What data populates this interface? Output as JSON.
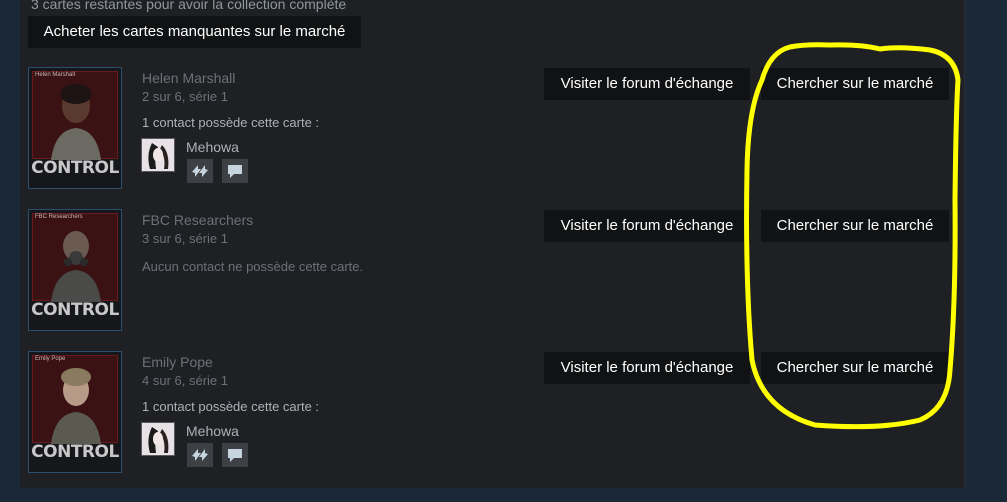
{
  "header": {
    "remaining_note": "3 cartes restantes pour avoir la collection complète",
    "buy_missing_label": "Acheter les cartes manquantes sur le marché"
  },
  "cards": [
    {
      "title": "Helen Marshall",
      "progress": "2 sur 6, série 1",
      "owners_text": "1 contact possède cette carte :",
      "friend_name": "Mehowa",
      "mini_label": "Helen Marshall",
      "logo": "CONTROL",
      "forum_label": "Visiter le forum d'échange",
      "market_label": "Chercher sur le marché"
    },
    {
      "title": "FBC Researchers",
      "progress": "3 sur 6, série 1",
      "owners_text": "Aucun contact ne possède cette carte.",
      "mini_label": "FBC Researchers",
      "logo": "CONTROL",
      "forum_label": "Visiter le forum d'échange",
      "market_label": "Chercher sur le marché"
    },
    {
      "title": "Emily Pope",
      "progress": "4 sur 6, série 1",
      "owners_text": "1 contact possède cette carte :",
      "friend_name": "Mehowa",
      "mini_label": "Emily Pope",
      "logo": "CONTROL",
      "forum_label": "Visiter le forum d'échange",
      "market_label": "Chercher sur le marché"
    }
  ],
  "icons": {
    "trade": "trade-icon",
    "chat": "chat-icon"
  },
  "colors": {
    "page_bg": "#1b2838",
    "panel_bg": "#1e2023",
    "button_bg": "#101214",
    "highlight": "#ffff00",
    "card_red": "#3a1214"
  }
}
